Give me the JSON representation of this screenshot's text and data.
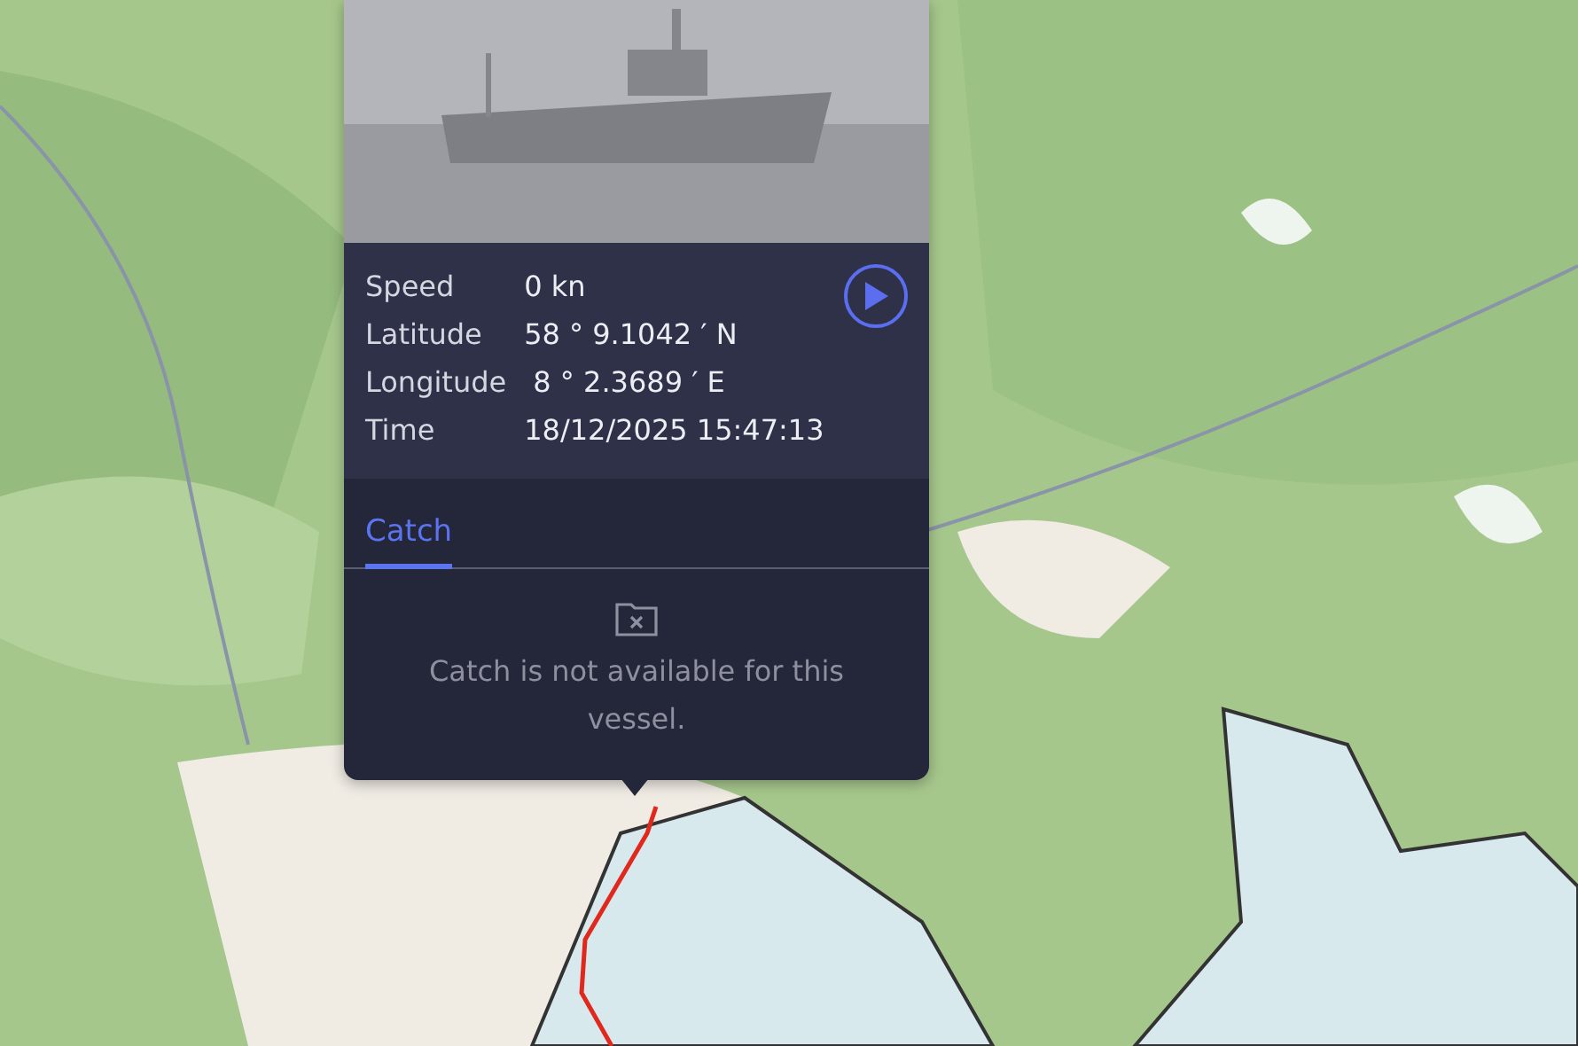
{
  "details": [
    {
      "label": "Speed",
      "value": "0 kn"
    },
    {
      "label": "Latitude",
      "value": "58 ° 9.1042 ′ N"
    },
    {
      "label": "Longitude",
      "value": " 8 ° 2.3689 ′ E"
    },
    {
      "label": "Time",
      "value": "18/12/2025 15:47:13"
    }
  ],
  "tabs": [
    {
      "label": "Catch",
      "selected": true
    }
  ],
  "empty_message": "Catch is not available for this vessel."
}
